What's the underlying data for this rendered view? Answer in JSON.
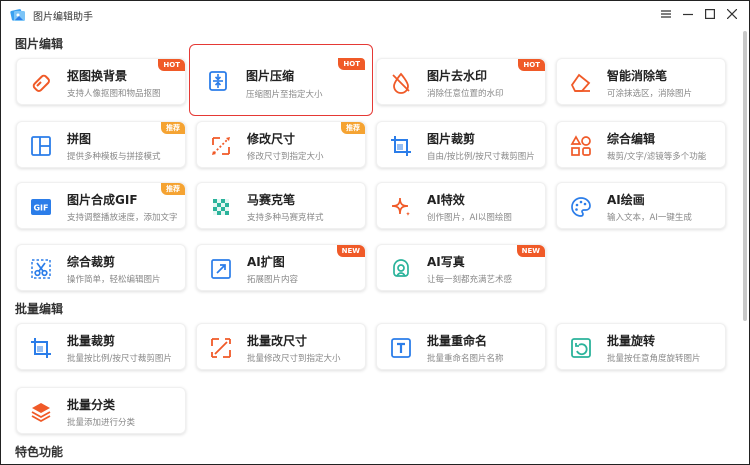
{
  "window": {
    "title": "图片编辑助手"
  },
  "sections": {
    "edit": "图片编辑",
    "batch": "批量编辑",
    "special": "特色功能"
  },
  "edit_cards": [
    {
      "name": "抠图换背景",
      "desc": "支持人像抠图和物品抠图",
      "badge": "HOT",
      "icon": "eraser-icon"
    },
    {
      "name": "图片压缩",
      "desc": "压缩图片至指定大小",
      "badge": "HOT",
      "icon": "compress-icon"
    },
    {
      "name": "图片去水印",
      "desc": "消除任意位置的水印",
      "badge": "HOT",
      "icon": "watermark-remove-icon"
    },
    {
      "name": "智能消除笔",
      "desc": "可涂抹选区，消除图片",
      "badge": "",
      "icon": "smart-eraser-icon"
    },
    {
      "name": "拼图",
      "desc": "提供多种模板与拼接模式",
      "badge": "推荐",
      "icon": "collage-icon"
    },
    {
      "name": "修改尺寸",
      "desc": "修改尺寸到指定大小",
      "badge": "推荐",
      "icon": "resize-icon"
    },
    {
      "name": "图片裁剪",
      "desc": "自由/按比例/按尺寸裁剪图片",
      "badge": "",
      "icon": "crop-icon"
    },
    {
      "name": "综合编辑",
      "desc": "裁剪/文字/滤镜等多个功能",
      "badge": "",
      "icon": "shapes-icon"
    },
    {
      "name": "图片合成GIF",
      "desc": "支持调整播放速度，添加文字",
      "badge": "推荐",
      "icon": "gif-icon"
    },
    {
      "name": "马赛克笔",
      "desc": "支持多种马赛克样式",
      "badge": "",
      "icon": "mosaic-icon"
    },
    {
      "name": "AI特效",
      "desc": "创作图片，AI以图绘图",
      "badge": "",
      "icon": "sparkle-icon"
    },
    {
      "name": "AI绘画",
      "desc": "输入文本，AI一键生成",
      "badge": "",
      "icon": "palette-icon"
    },
    {
      "name": "综合裁剪",
      "desc": "操作简单，轻松编辑图片",
      "badge": "",
      "icon": "scissors-icon"
    },
    {
      "name": "AI扩图",
      "desc": "拓展图片内容",
      "badge": "NEW",
      "icon": "expand-icon"
    },
    {
      "name": "AI写真",
      "desc": "让每一刻都充满艺术感",
      "badge": "NEW",
      "icon": "portrait-icon"
    }
  ],
  "batch_cards": [
    {
      "name": "批量裁剪",
      "desc": "批量按比例/按尺寸裁剪图片",
      "icon": "batch-crop-icon"
    },
    {
      "name": "批量改尺寸",
      "desc": "批量修改尺寸到指定大小",
      "icon": "batch-resize-icon"
    },
    {
      "name": "批量重命名",
      "desc": "批量重命名图片名称",
      "icon": "batch-rename-icon"
    },
    {
      "name": "批量旋转",
      "desc": "批量按任意角度旋转图片",
      "icon": "batch-rotate-icon"
    },
    {
      "name": "批量分类",
      "desc": "批量添加进行分类",
      "icon": "batch-classify-icon"
    }
  ],
  "colors": {
    "accent": "#f05a28",
    "blue": "#2b7de9",
    "selected_border": "#e53935"
  }
}
